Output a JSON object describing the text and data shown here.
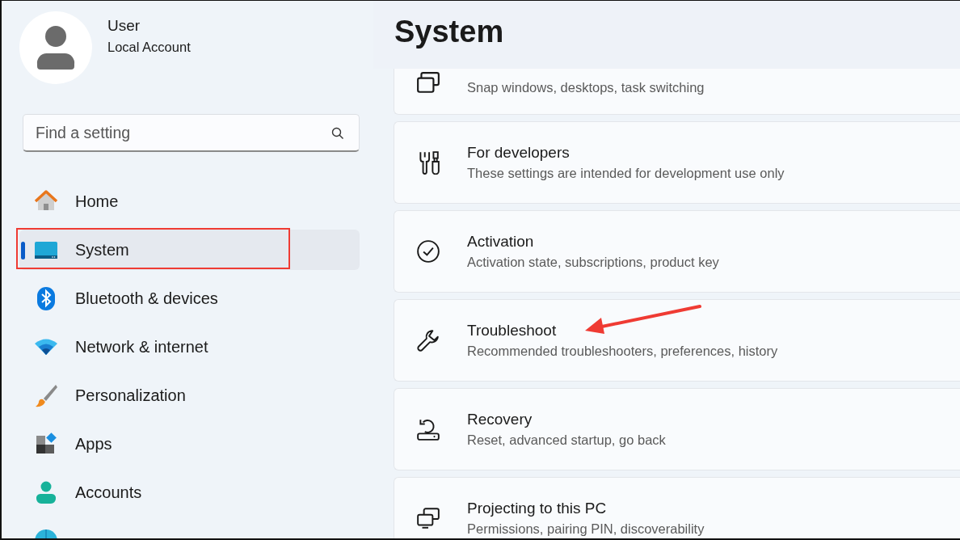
{
  "user": {
    "name": "User",
    "account": "Local Account"
  },
  "search": {
    "placeholder": "Find a setting"
  },
  "nav": [
    {
      "label": "Home",
      "kind": "home",
      "selected": false,
      "highlighted": false
    },
    {
      "label": "System",
      "kind": "system",
      "selected": true,
      "highlighted": true
    },
    {
      "label": "Bluetooth & devices",
      "kind": "bluetooth",
      "selected": false,
      "highlighted": false
    },
    {
      "label": "Network & internet",
      "kind": "network",
      "selected": false,
      "highlighted": false
    },
    {
      "label": "Personalization",
      "kind": "brush",
      "selected": false,
      "highlighted": false
    },
    {
      "label": "Apps",
      "kind": "apps",
      "selected": false,
      "highlighted": false
    },
    {
      "label": "Accounts",
      "kind": "accounts",
      "selected": false,
      "highlighted": false
    },
    {
      "kind": "globe",
      "selected": false,
      "highlighted": false
    }
  ],
  "page": {
    "title": "System"
  },
  "cards": [
    {
      "kind": "multitasking",
      "description": "Snap windows, desktops, task switching",
      "pointed": false
    },
    {
      "kind": "developers",
      "title": "For developers",
      "description": "These settings are intended for development use only",
      "pointed": false
    },
    {
      "kind": "activation",
      "title": "Activation",
      "description": "Activation state, subscriptions, product key",
      "pointed": false
    },
    {
      "kind": "troubleshoot",
      "title": "Troubleshoot",
      "description": "Recommended troubleshooters, preferences, history",
      "pointed": true
    },
    {
      "kind": "recovery",
      "title": "Recovery",
      "description": "Reset, advanced startup, go back",
      "pointed": false
    },
    {
      "kind": "projecting",
      "title": "Projecting to this PC",
      "description": "Permissions, pairing PIN, discoverability",
      "pointed": false
    }
  ]
}
